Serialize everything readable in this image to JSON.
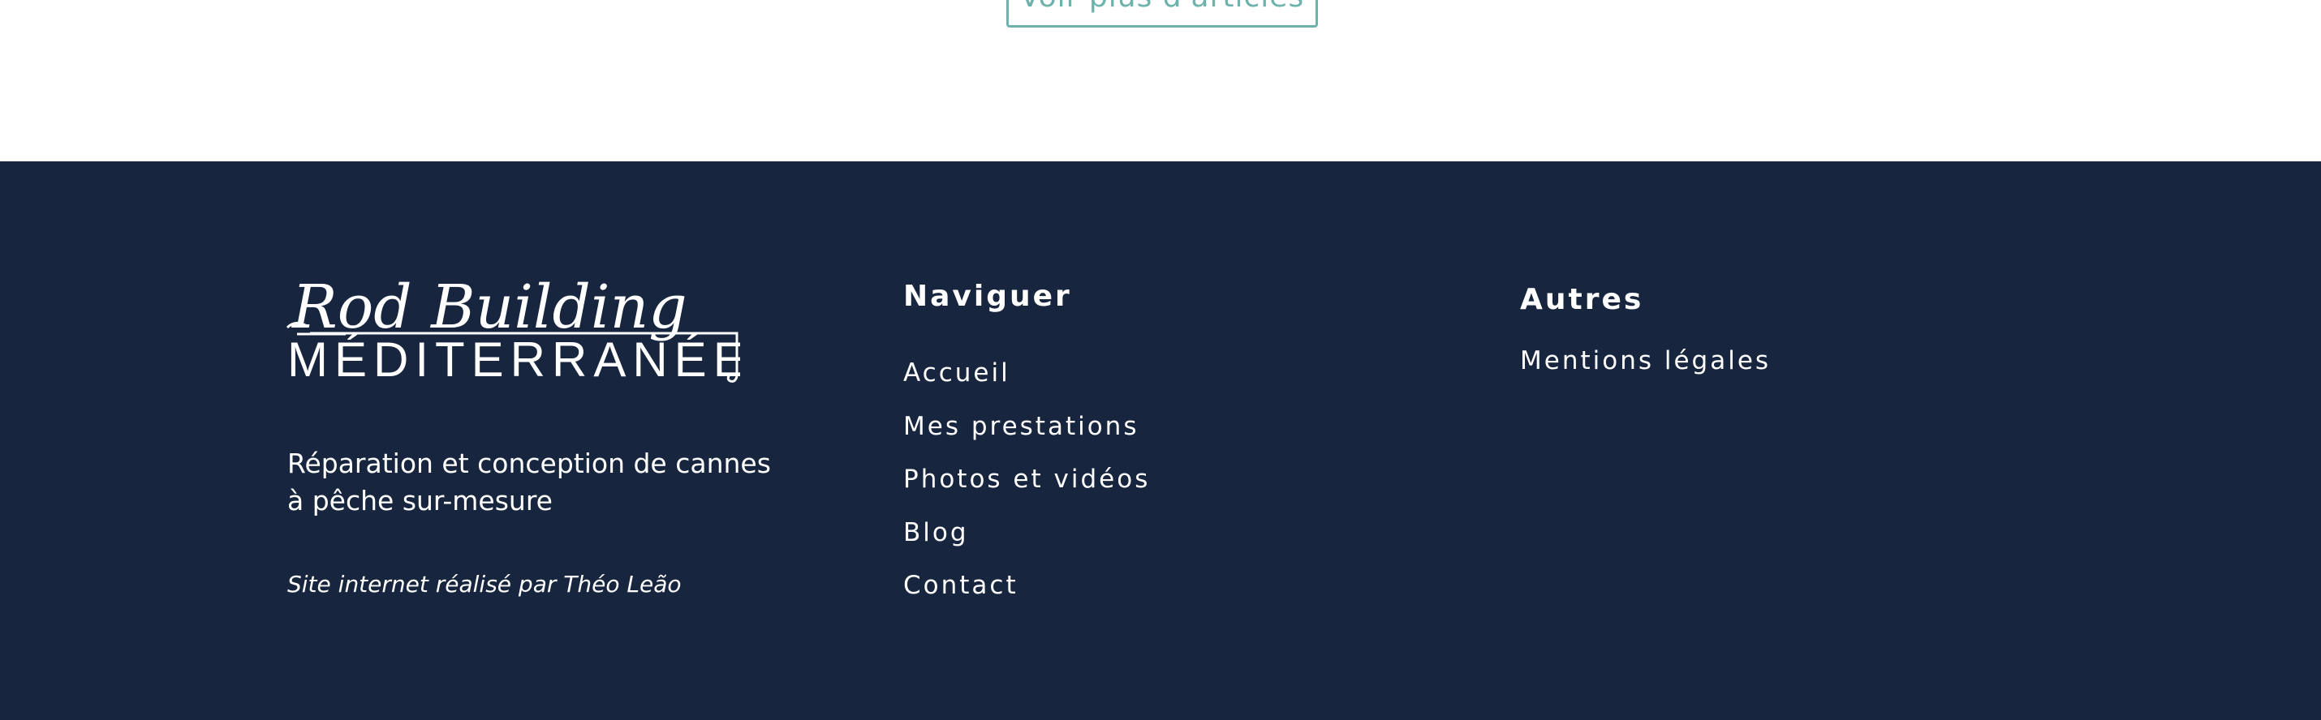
{
  "top": {
    "more_button_label": "Voir plus d'articles"
  },
  "footer": {
    "logo": {
      "line1": "Rod Building",
      "line2": "MÉDITERRANÉE"
    },
    "tagline": "Réparation et conception de cannes à pêche sur-mesure",
    "credit": "Site internet réalisé par Théo Leão",
    "navigate": {
      "title": "Naviguer",
      "items": [
        "Accueil",
        "Mes prestations",
        "Photos et vidéos",
        "Blog",
        "Contact"
      ]
    },
    "others": {
      "title": "Autres",
      "items": [
        "Mentions légales"
      ]
    }
  },
  "colors": {
    "footer_bg": "#17263e",
    "accent": "#6db3ac",
    "text": "#ffffff"
  }
}
